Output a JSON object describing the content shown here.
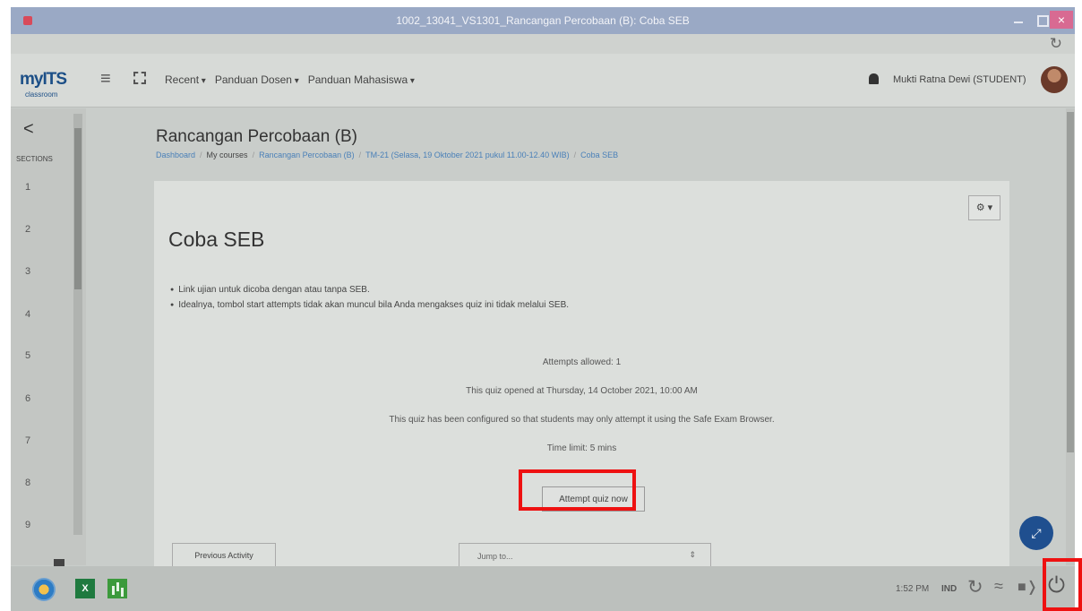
{
  "window": {
    "title": "1002_13041_VS1301_Rancangan Percobaan (B): Coba SEB",
    "close_label": "×"
  },
  "navbar": {
    "logo": "myITS",
    "logo_sub": "classroom",
    "menu": [
      "Recent",
      "Panduan Dosen",
      "Panduan Mahasiswa"
    ],
    "user": "Mukti Ratna Dewi (STUDENT)"
  },
  "drawer": {
    "back": "<",
    "label": "SECTIONS",
    "sections": [
      "1",
      "2",
      "3",
      "4",
      "5",
      "6",
      "7",
      "8",
      "9"
    ]
  },
  "page": {
    "course_title": "Rancangan Percobaan (B)",
    "breadcrumb": [
      "Dashboard",
      "My courses",
      "Rancangan Percobaan (B)",
      "TM-21 (Selasa, 19 Oktober 2021 pukul 11.00-12.40 WIB)",
      "Coba SEB"
    ],
    "gear": "⚙ ▾"
  },
  "quiz": {
    "title": "Coba SEB",
    "description": [
      "Link ujian untuk dicoba dengan atau tanpa SEB.",
      "Idealnya, tombol start attempts tidak akan muncul bila Anda mengakses quiz ini tidak melalui SEB."
    ],
    "attempts_allowed": "Attempts allowed: 1",
    "opened": "This quiz opened at Thursday, 14 October 2021, 10:00 AM",
    "seb_note": "This quiz has been configured so that students may only attempt it using the Safe Exam Browser.",
    "time_limit": "Time limit: 5 mins",
    "attempt_button": "Attempt quiz now"
  },
  "footer_nav": {
    "previous": "Previous Activity",
    "jump_to": "Jump to...",
    "jump_arrow": "⇕"
  },
  "fab_icon": "⤢",
  "taskbar": {
    "time": "1:52 PM",
    "lang": "IND",
    "excel": "X"
  },
  "colors": {
    "highlight": "#ee1111",
    "link": "#4a80b8",
    "fab": "#1f4f8f"
  }
}
